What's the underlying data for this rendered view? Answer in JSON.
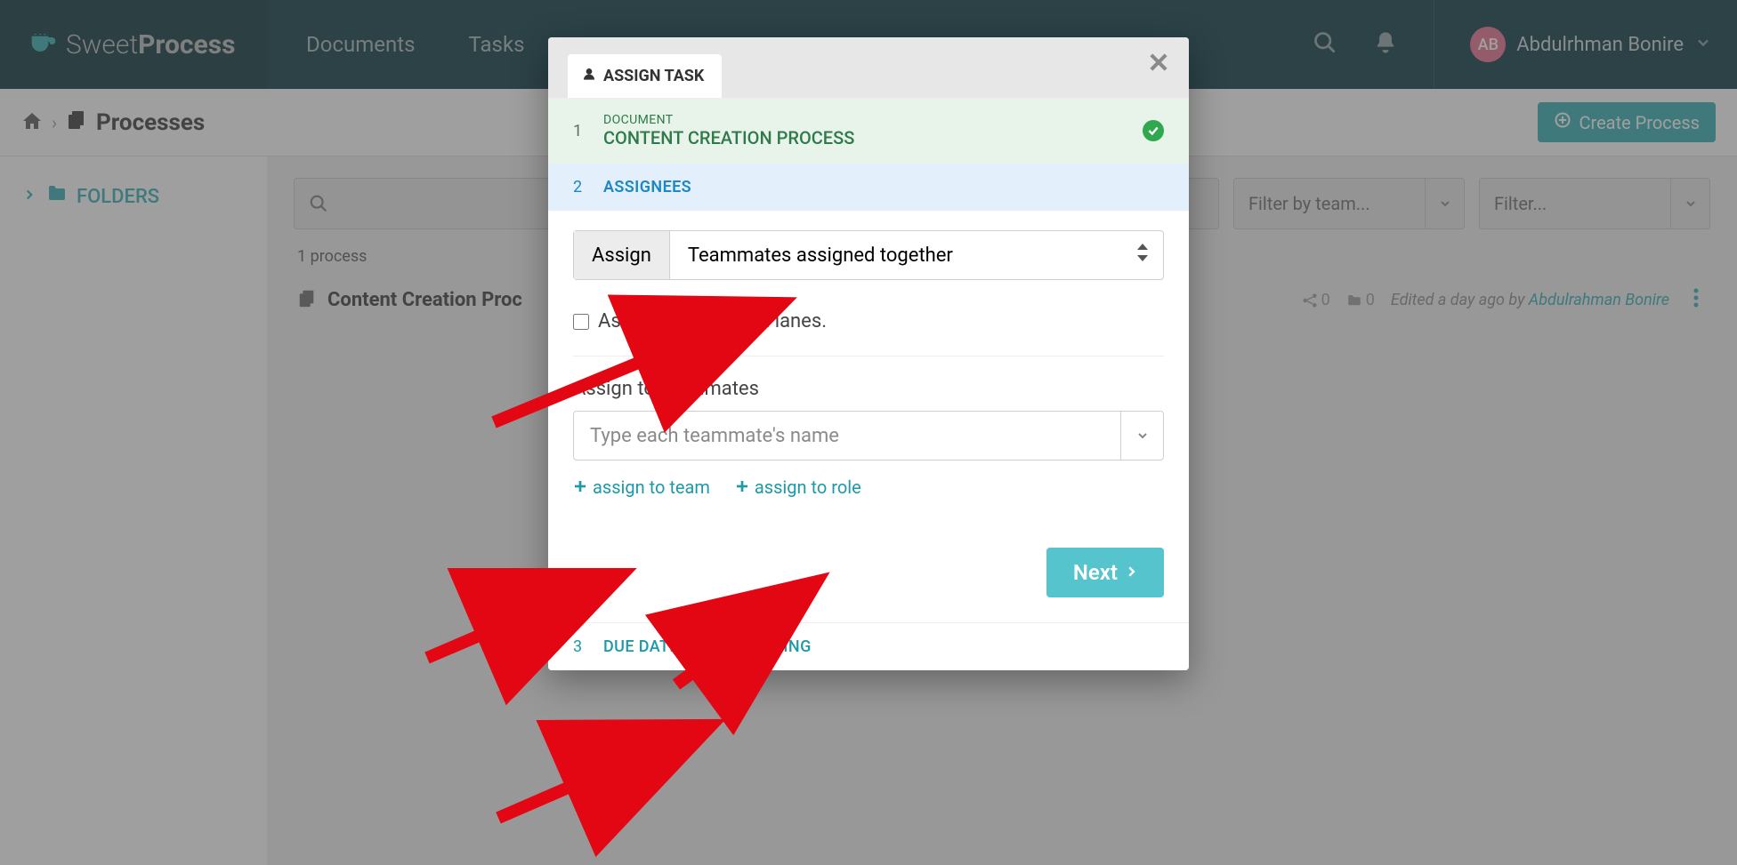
{
  "brand": {
    "name_light": "Sweet",
    "name_bold": "Process"
  },
  "nav": {
    "documents": "Documents",
    "tasks": "Tasks"
  },
  "user": {
    "initials": "AB",
    "name": "Abdulrhman Bonire"
  },
  "breadcrumb": {
    "current": "Processes"
  },
  "buttons": {
    "create_process": "Create Process"
  },
  "sidebar": {
    "folders": "FOLDERS"
  },
  "filters": {
    "team_placeholder": "Filter by team...",
    "generic_placeholder": "Filter..."
  },
  "list": {
    "count_text": "1 process",
    "items": [
      {
        "title": "Content Creation Proc",
        "share_count": "0",
        "folder_count": "0",
        "edited_prefix": "Edited a day ago by ",
        "edited_by": "Abdulrahman Bonire"
      }
    ]
  },
  "modal": {
    "tab_label": "ASSIGN TASK",
    "step1": {
      "num": "1",
      "label": "DOCUMENT",
      "name": "CONTENT CREATION PROCESS"
    },
    "step2": {
      "num": "2",
      "label": "ASSIGNEES",
      "assign_label": "Assign",
      "assign_mode": "Teammates assigned together",
      "assign_steps_lanes": "Assign to steps and lanes.",
      "assign_to_teammates": "Assign to teammates",
      "teammate_placeholder": "Type each teammate's name",
      "assign_team_link": "assign to team",
      "assign_role_link": "assign to role",
      "next": "Next"
    },
    "step3": {
      "num": "3",
      "label": "DUE DATE AND RECURRING"
    }
  }
}
